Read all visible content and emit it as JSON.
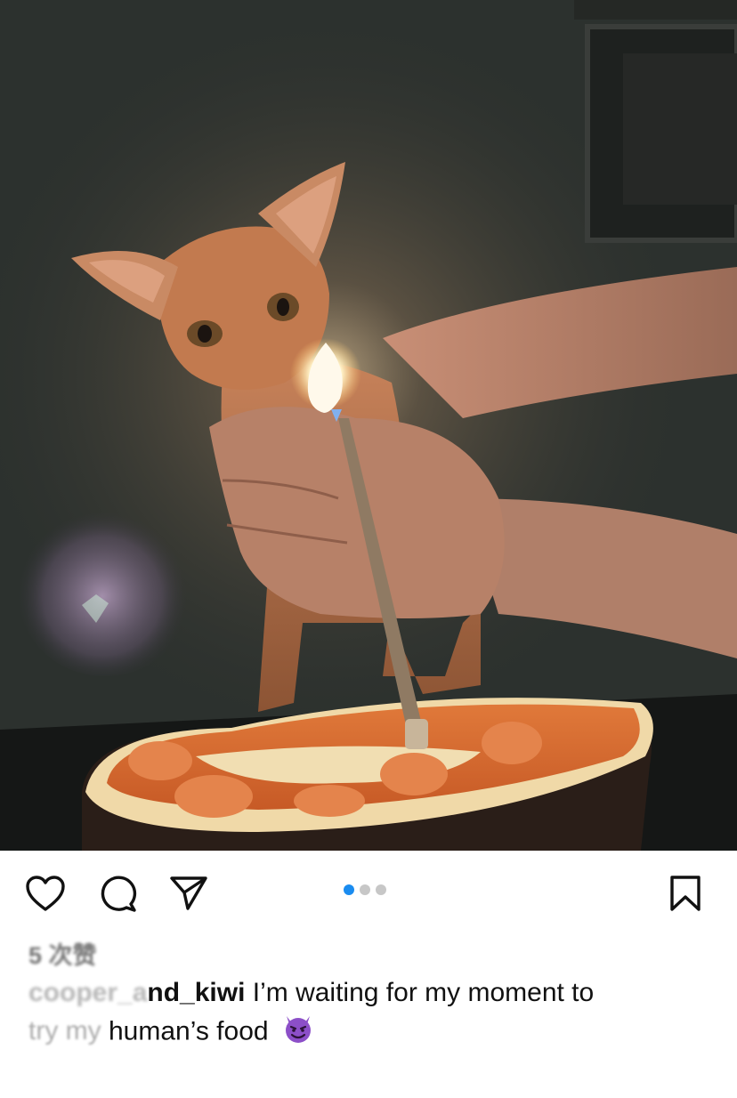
{
  "post": {
    "photo_alt": "",
    "carousel": {
      "count": 3,
      "active_index": 0
    },
    "likes_text": "5 次赞",
    "username_hidden_part": "cooper_a",
    "username_visible_part": "nd_kiwi",
    "caption_line1": " I’m waiting for my moment to",
    "caption_blurred_part": "try my ",
    "caption_line2": "human’s food",
    "caption_emoji": "devil-emoji"
  },
  "actions": {
    "like_icon": "heart-icon",
    "comment_icon": "comment-icon",
    "share_icon": "share-icon",
    "save_icon": "bookmark-icon"
  },
  "colors": {
    "accent_dot": "#1a8cf0",
    "inactive_dot": "#c7c7c7",
    "devil_purple": "#8c4fc8"
  }
}
